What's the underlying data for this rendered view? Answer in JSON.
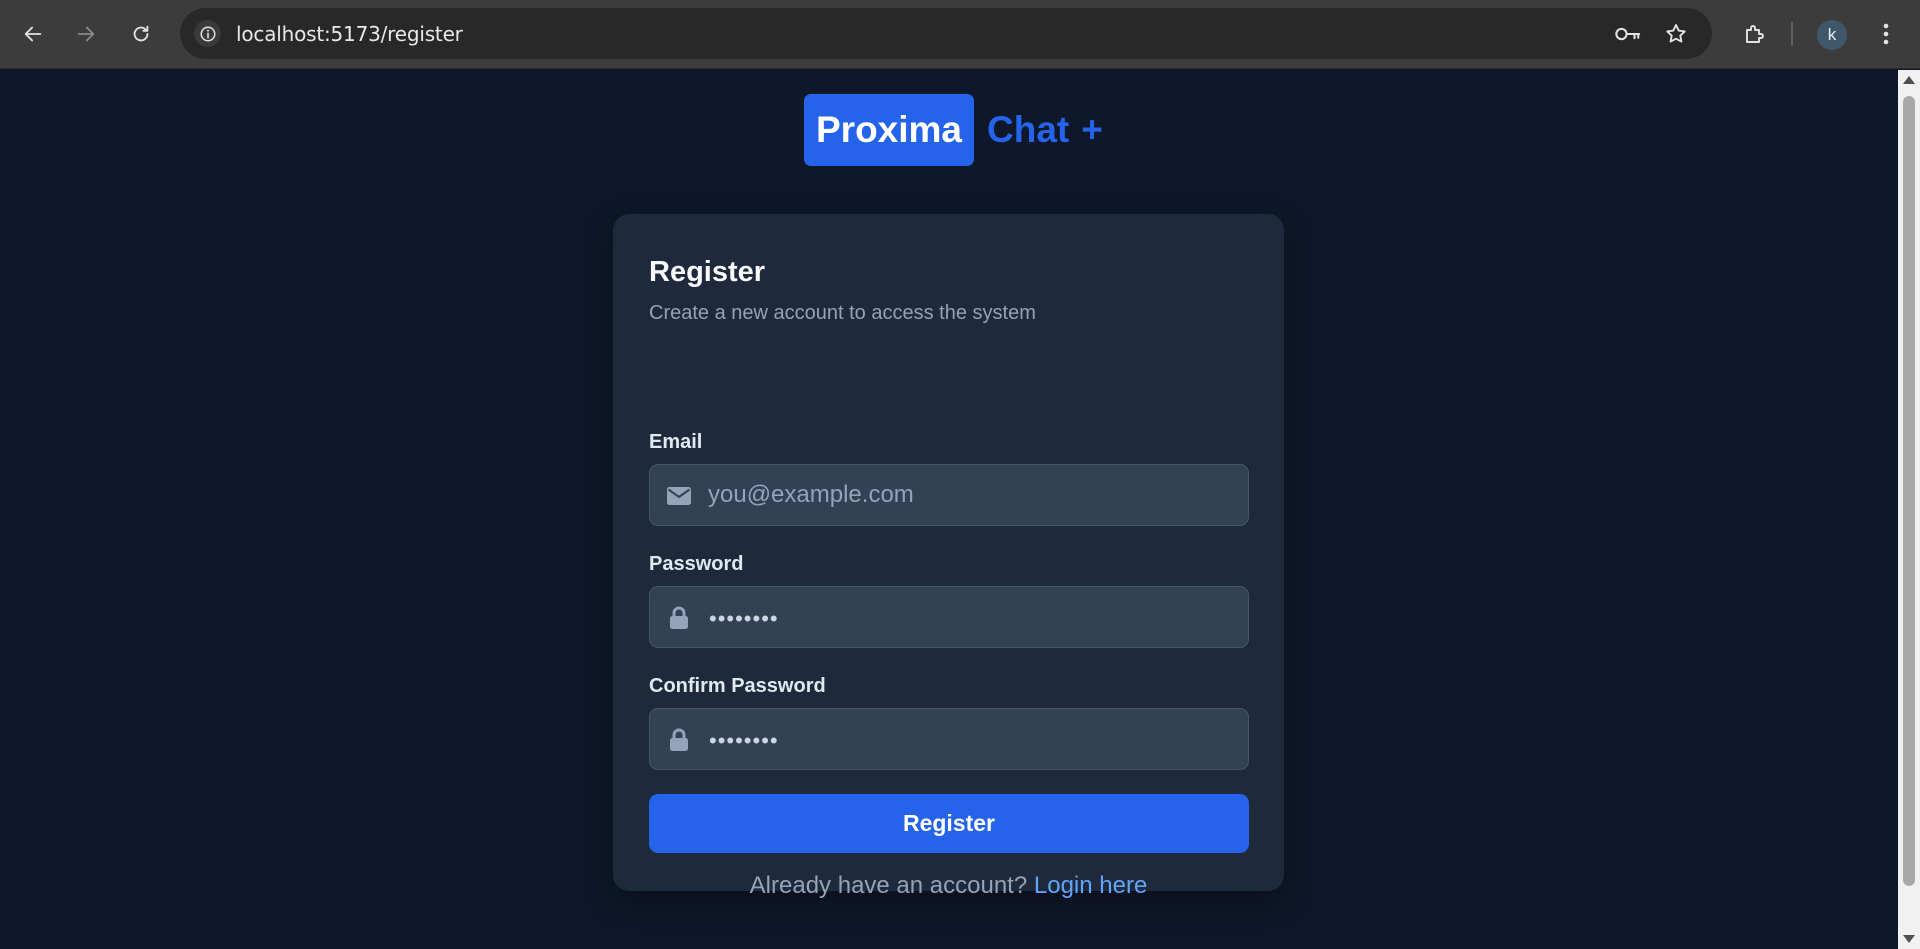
{
  "browser": {
    "url_host": "localhost:5173",
    "url_path": "/register",
    "profile_initial": "k",
    "icons": {
      "back": "arrow-left-icon",
      "forward": "arrow-right-icon",
      "reload": "reload-icon",
      "site_info": "info-icon",
      "password_key": "key-icon",
      "bookmark": "star-icon",
      "extensions": "puzzle-icon",
      "menu": "kebab-menu-icon"
    }
  },
  "brand": {
    "name_boxed": "Proxima",
    "name_rest": "Chat",
    "plus": "+",
    "accent_color": "#2563eb"
  },
  "form": {
    "title": "Register",
    "subtitle": "Create a new account to access the system",
    "email": {
      "label": "Email",
      "placeholder": "you@example.com",
      "icon": "envelope-icon"
    },
    "password": {
      "label": "Password",
      "masked_value": "••••••••",
      "icon": "lock-icon"
    },
    "confirm_password": {
      "label": "Confirm Password",
      "masked_value": "••••••••",
      "icon": "lock-icon"
    },
    "submit_label": "Register",
    "login_prompt": "Already have an account?",
    "login_link": "Login here"
  },
  "colors": {
    "page_bg": "#0f172a",
    "card_bg": "#1e293b",
    "input_bg": "#334155",
    "button_bg": "#2563eb",
    "link": "#60a5fa"
  }
}
